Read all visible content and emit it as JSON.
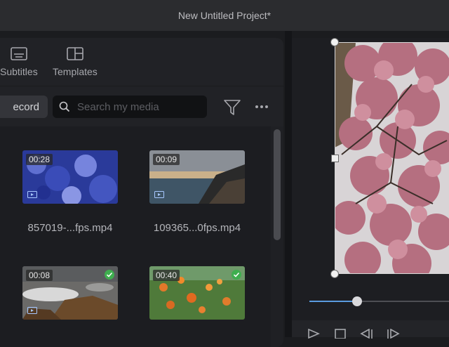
{
  "window": {
    "title": "New Untitled Project*"
  },
  "tabs": [
    {
      "label": "Subtitles",
      "icon": "subtitles-icon"
    },
    {
      "label": "Templates",
      "icon": "templates-icon"
    }
  ],
  "toolbar": {
    "record_label": "ecord",
    "search_placeholder": "Search my media",
    "filter_icon": "filter-icon",
    "more_icon": "more-icon"
  },
  "media": [
    {
      "duration": "00:28",
      "filename": "857019-...fps.mp4",
      "selected": false,
      "theme": "blue-forest"
    },
    {
      "duration": "00:09",
      "filename": "109365...0fps.mp4",
      "selected": false,
      "theme": "sea-cliff"
    },
    {
      "duration": "00:08",
      "filename": "",
      "selected": true,
      "theme": "rocky-waves"
    },
    {
      "duration": "00:40",
      "filename": "",
      "selected": true,
      "theme": "orange-flowers"
    }
  ],
  "preview": {
    "content": "pink cherry blossoms",
    "playhead_progress": 0.34
  },
  "colors": {
    "accent": "#5a9be0",
    "background": "#1b1c1f",
    "panel": "#212226",
    "check": "#3fae4f"
  }
}
